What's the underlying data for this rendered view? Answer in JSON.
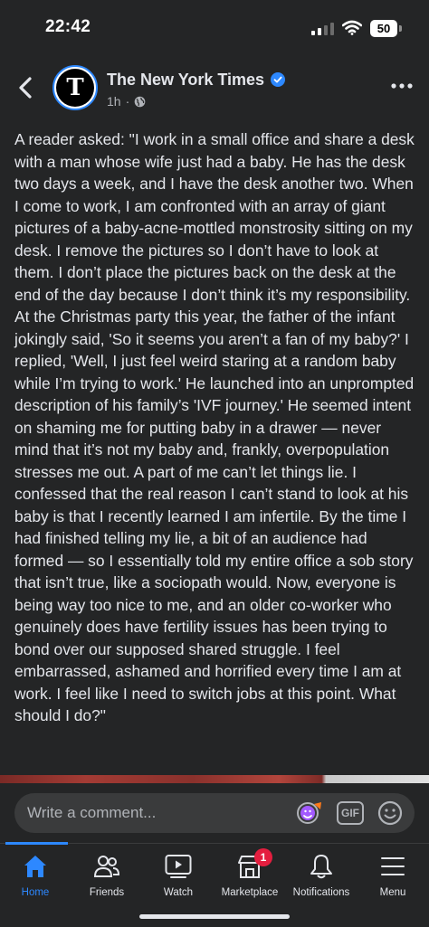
{
  "status_bar": {
    "time": "22:42",
    "battery": "50"
  },
  "header": {
    "page_name": "The New York Times",
    "time_ago": "1h",
    "separator": "·",
    "avatar_letter": "T",
    "verified_color": "#2d88ff"
  },
  "post": {
    "text": "A reader asked: \"I work in a small office and share a desk with a man whose wife just had a baby. He has the desk two days a week, and I have the desk another two. When I come to work, I am confronted with an array of giant pictures of a baby-acne-mottled monstrosity sitting on my desk. I remove the pictures so I don’t have to look at them. I don’t place the pictures back on the desk at the end of the day because I don’t think it’s my responsibility. At the Christmas party this year, the father of the infant jokingly said, 'So it seems you aren’t a fan of my baby?' I replied, 'Well, I just feel weird staring at a random baby while I’m trying to work.' He launched into an unprompted description of his family’s 'IVF journey.' He seemed intent on shaming me for putting baby in a drawer — never mind that it’s not my baby and, frankly, overpopulation stresses me out. A part of me can’t let things lie. I confessed that the real reason I can’t stand to look at his baby is that I recently learned I am infertile. By the time I had finished telling my lie, a bit of an audience had formed — so I essentially told my entire office a sob story that isn’t true, like a sociopath would. Now, everyone is being way too nice to me, and an older co-worker who genuinely does have fertility issues has been trying to bond over our supposed shared struggle. I feel embarrassed, ashamed and horrified every time I am at work. I feel like I need to switch jobs at this point. What should I do?\""
  },
  "comment": {
    "placeholder": "Write a comment...",
    "gif_label": "GIF"
  },
  "tabs": [
    {
      "label": "Home",
      "icon": "home-icon",
      "active": true
    },
    {
      "label": "Friends",
      "icon": "friends-icon"
    },
    {
      "label": "Watch",
      "icon": "watch-icon"
    },
    {
      "label": "Marketplace",
      "icon": "marketplace-icon",
      "badge": "1"
    },
    {
      "label": "Notifications",
      "icon": "bell-icon"
    },
    {
      "label": "Menu",
      "icon": "menu-icon"
    }
  ],
  "colors": {
    "background": "#242526",
    "accent": "#2d88ff",
    "badge": "#e41e3f"
  }
}
